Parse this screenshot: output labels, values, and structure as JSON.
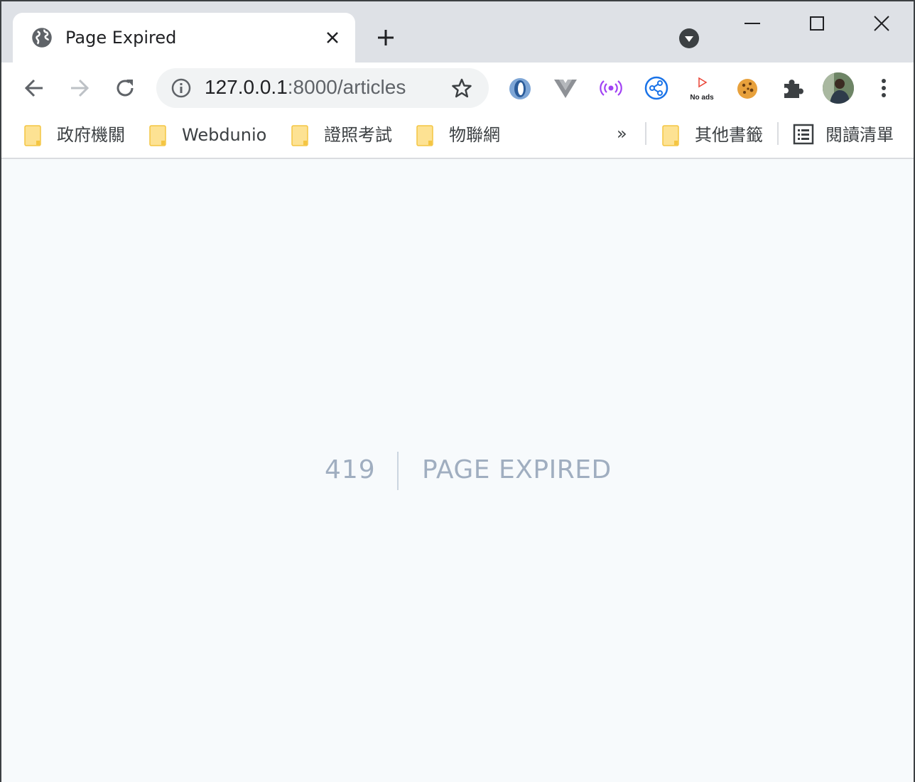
{
  "tab": {
    "title": "Page Expired",
    "favicon": "globe-icon"
  },
  "toolbar": {
    "url_host": "127.0.0.1",
    "url_path": ":8000/articles",
    "extensions": [
      "json-viewer-icon",
      "vue-devtools-icon",
      "broadcast-icon",
      "share-icon",
      "no-ads-icon",
      "cookie-icon",
      "puzzle-extensions-icon"
    ],
    "noads_label": "No ads"
  },
  "bookmarks": {
    "items": [
      {
        "label": "政府機關"
      },
      {
        "label": "Webdunio"
      },
      {
        "label": "證照考試"
      },
      {
        "label": "物聯網"
      }
    ],
    "overflow": "»",
    "other": "其他書籤",
    "reading_list": "閱讀清單"
  },
  "page": {
    "code": "419",
    "message": "PAGE EXPIRED"
  },
  "colors": {
    "accent": "#1a73e8",
    "folder": "#fde293",
    "error_text": "#a0aec0",
    "content_bg": "#f7fafc"
  }
}
